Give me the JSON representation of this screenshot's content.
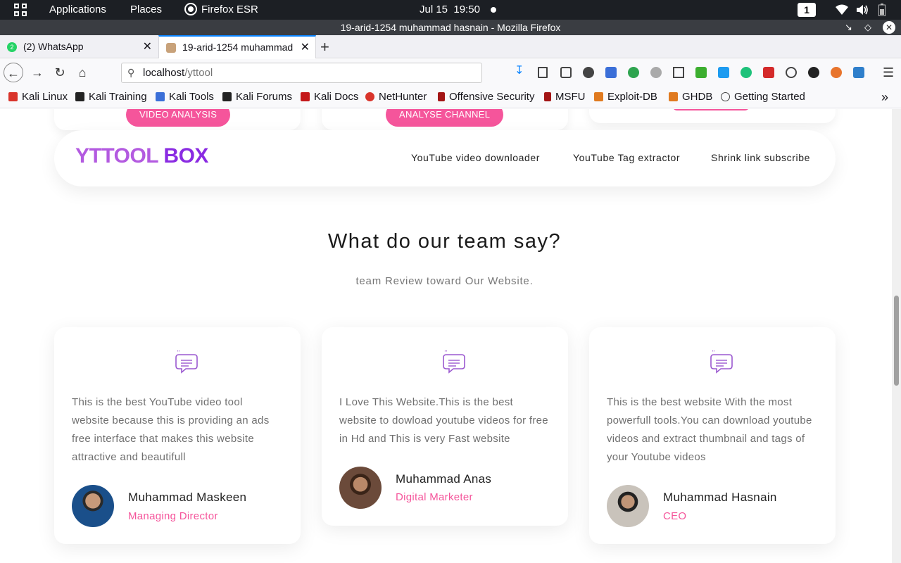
{
  "system_bar": {
    "applications": "Applications",
    "places": "Places",
    "browser_app": "Firefox ESR",
    "date": "Jul 15",
    "time": "19:50",
    "workspace": "1"
  },
  "window": {
    "title": "19-arid-1254 muhammad hasnain - Mozilla Firefox"
  },
  "tabs": [
    {
      "label": "(2) WhatsApp",
      "badge": "2",
      "active": false
    },
    {
      "label": "19-arid-1254 muhammad hasnain",
      "active": true
    }
  ],
  "navbar": {
    "url_host": "localhost",
    "url_path": "/yttool"
  },
  "bookmarks": [
    {
      "label": "Kali Linux",
      "icon": "kali-icon"
    },
    {
      "label": "Kali Training",
      "icon": "kali-dragon-icon"
    },
    {
      "label": "Kali Tools",
      "icon": "kali-icon"
    },
    {
      "label": "Kali Forums",
      "icon": "kali-dragon-icon"
    },
    {
      "label": "Kali Docs",
      "icon": "docs-icon"
    },
    {
      "label": "NetHunter",
      "icon": "kali-icon"
    },
    {
      "label": "Offensive Security",
      "icon": "offsec-icon"
    },
    {
      "label": "MSFU",
      "icon": "offsec-icon"
    },
    {
      "label": "Exploit-DB",
      "icon": "exploitdb-icon"
    },
    {
      "label": "GHDB",
      "icon": "exploitdb-icon"
    },
    {
      "label": "Getting Started",
      "icon": "globe-icon"
    }
  ],
  "page": {
    "top_buttons": {
      "video_analysis": "VIDEO ANALYSIS",
      "analyse_channel": "ANALYSE CHANNEL"
    },
    "header": {
      "logo_part1": "YTTOOL",
      "logo_part2": "BOX",
      "menu": [
        "YouTube video downloader",
        "YouTube Tag extractor",
        "Shrink link subscribe"
      ]
    },
    "testimonials": {
      "title": "What do our team say?",
      "subtitle": "team Review toward Our Website.",
      "items": [
        {
          "text": "This is the best YouTube video tool website because this is providing an ads free interface that makes this website attractive and beautifull",
          "name": "Muhammad Maskeen",
          "role": "Managing Director"
        },
        {
          "text": "I Love This Website.This is the best website to dowload youtube videos for free in Hd and This is very Fast website",
          "name": "Muhammad Anas",
          "role": "Digital Marketer"
        },
        {
          "text": "This is the best website With the most powerfull tools.You can download youtube videos and extract thumbnail and tags of your Youtube videos",
          "name": "Muhammad Hasnain",
          "role": "CEO"
        }
      ]
    }
  },
  "colors": {
    "accent_pink": "#f5559b",
    "logo_purple_light": "#b35ae0",
    "logo_purple_dark": "#8a2be2",
    "quote_icon": "#9b59d0"
  }
}
